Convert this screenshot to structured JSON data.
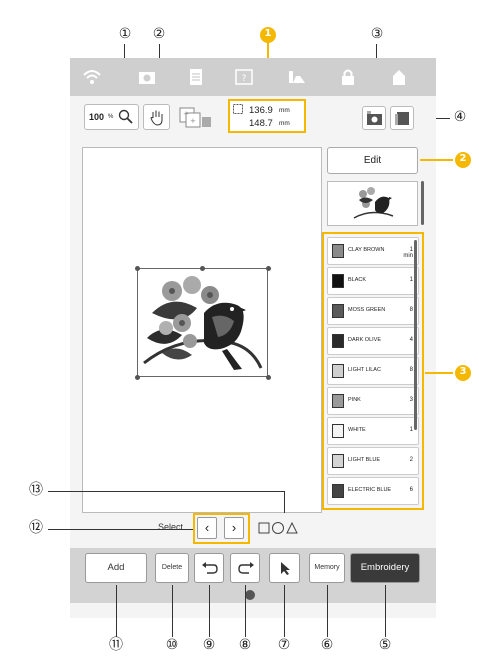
{
  "status_icons": [
    "wifi-icon",
    "camera-icon",
    "document-icon",
    "help-icon",
    "sewing-icon",
    "lock-icon",
    "home-icon"
  ],
  "toolbar": {
    "zoom_value": "100",
    "zoom_unit": "%",
    "size_width": "136.9",
    "size_height": "148.7",
    "size_unit": "mm"
  },
  "edit_label": "Edit",
  "threads": [
    {
      "name": "CLAY BROWN",
      "count": "1",
      "extra": "min",
      "color": "#8a8a8a"
    },
    {
      "name": "BLACK",
      "count": "1",
      "extra": "",
      "color": "#111111"
    },
    {
      "name": "MOSS GREEN",
      "count": "8",
      "extra": "",
      "color": "#5a5a5a"
    },
    {
      "name": "DARK OLIVE",
      "count": "4",
      "extra": "",
      "color": "#2a2a2a"
    },
    {
      "name": "LIGHT LILAC",
      "count": "8",
      "extra": "",
      "color": "#cfcfcf"
    },
    {
      "name": "PINK",
      "count": "3",
      "extra": "",
      "color": "#9a9a9a"
    },
    {
      "name": "WHITE",
      "count": "1",
      "extra": "",
      "color": "#f4f4f4"
    },
    {
      "name": "LIGHT BLUE",
      "count": "2",
      "extra": "",
      "color": "#d4d4d4"
    },
    {
      "name": "ELECTRIC BLUE",
      "count": "6",
      "extra": "",
      "color": "#444444"
    }
  ],
  "select_label": "Select",
  "bottom_buttons": {
    "add": "Add",
    "delete": "Delete",
    "memory": "Memory",
    "embroidery": "Embroidery"
  },
  "callouts": {
    "c1": "①",
    "c2": "②",
    "c3": "③",
    "c4": "④",
    "c5": "⑤",
    "c6": "⑥",
    "c7": "⑦",
    "c8": "⑧",
    "c9": "⑨",
    "c10": "⑩",
    "c11": "⑪",
    "c12": "⑫",
    "c13": "⑬",
    "y1": "1",
    "y2": "2",
    "y3": "3"
  },
  "colors": {
    "accent": "#f5b800",
    "dark_button": "#3a3a3a",
    "status_bar": "#cfcfcf"
  }
}
